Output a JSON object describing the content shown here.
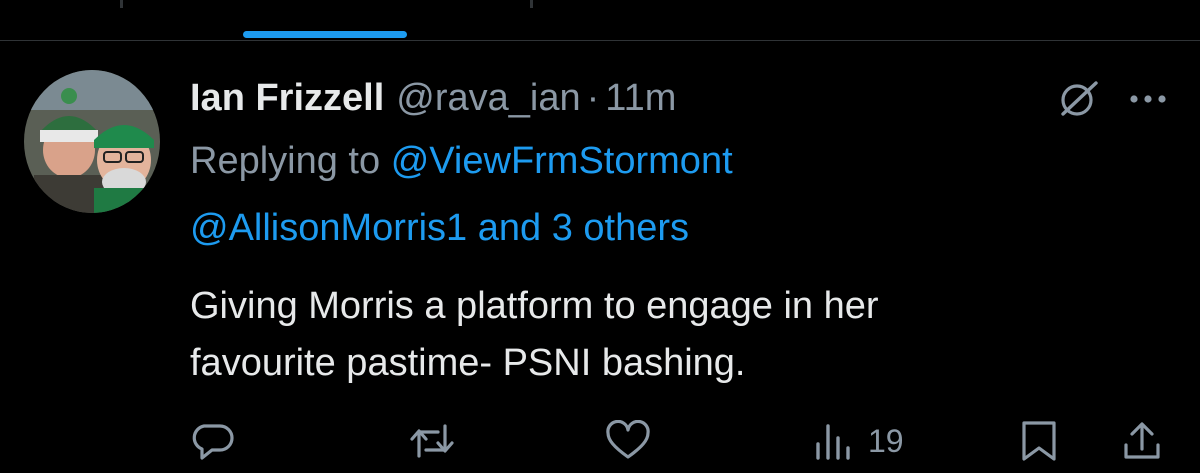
{
  "tweet": {
    "display_name": "Ian Frizzell",
    "handle": "@rava_ian",
    "separator": "·",
    "time": "11m",
    "replying_prefix": "Replying to",
    "reply_mention_primary": "@ViewFrmStormont",
    "reply_mention_secondary": "@AllisonMorris1 and 3 others",
    "text_line1": "Giving Morris a platform to engage in her",
    "text_line2": "favourite pastime- PSNI bashing."
  },
  "actions": {
    "views_count": "19"
  },
  "icons": {
    "avatar": "avatar-photo",
    "grok": "grok-icon",
    "more": "more-icon",
    "reply": "reply-icon",
    "retweet": "retweet-icon",
    "like": "like-icon",
    "views": "views-icon",
    "bookmark": "bookmark-icon",
    "share": "share-icon"
  },
  "colors": {
    "background": "#000000",
    "text_primary": "#e7e9ea",
    "text_secondary": "#8b98a5",
    "accent": "#1d9bf0",
    "divider": "#2f3336"
  }
}
